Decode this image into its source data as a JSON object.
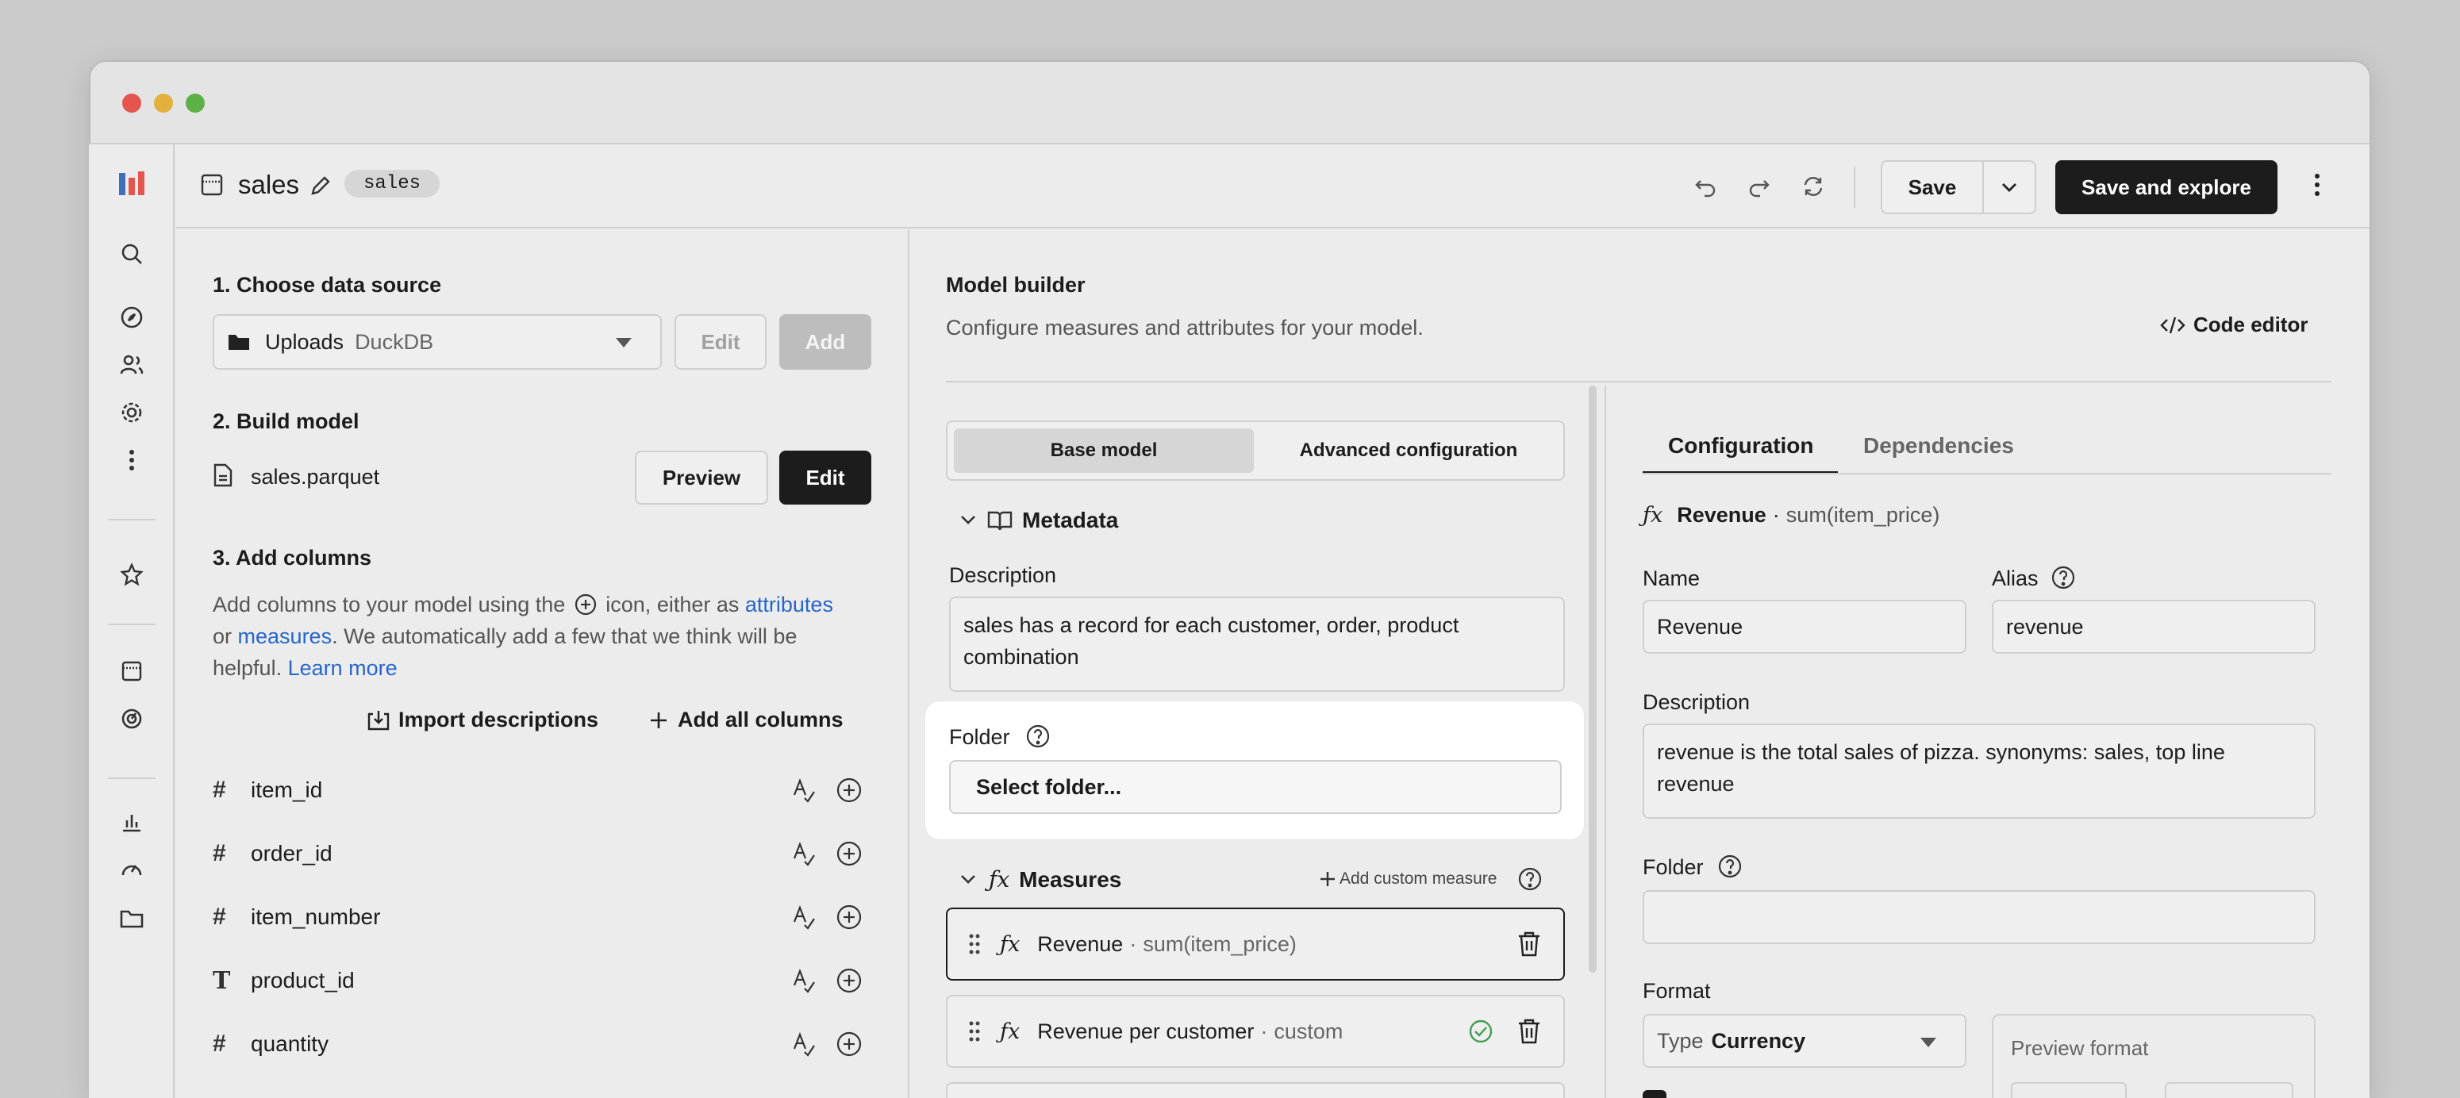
{
  "model": {
    "name": "sales",
    "tag": "sales"
  },
  "toolbar": {
    "save": "Save",
    "save_explore": "Save and explore"
  },
  "left": {
    "step1": "1. Choose data source",
    "source_label": "Uploads",
    "source_engine": "DuckDB",
    "edit": "Edit",
    "add": "Add",
    "step2": "2. Build model",
    "file": "sales.parquet",
    "preview": "Preview",
    "edit2": "Edit",
    "step3": "3. Add columns",
    "help_p1": "Add columns to your model using the",
    "help_p2": "icon, either as",
    "help_attributes": "attributes",
    "help_or": "or",
    "help_measures": "measures",
    "help_p3": ". We automatically add a few that we think will be",
    "help_p4": "helpful.",
    "help_learn": "Learn more",
    "import": "Import descriptions",
    "add_all": "Add all columns",
    "columns": [
      {
        "type": "#",
        "name": "item_id"
      },
      {
        "type": "#",
        "name": "order_id"
      },
      {
        "type": "#",
        "name": "item_number"
      },
      {
        "type": "T",
        "name": "product_id"
      },
      {
        "type": "#",
        "name": "quantity"
      }
    ]
  },
  "builder": {
    "title": "Model builder",
    "subtitle": "Configure measures and attributes for your model.",
    "code_editor": "Code editor",
    "tab_base": "Base model",
    "tab_advanced": "Advanced configuration",
    "metadata": "Metadata",
    "description_label": "Description",
    "description_value": "sales has a record for each customer, order, product combination",
    "folder_label": "Folder",
    "folder_placeholder": "Select folder...",
    "measures": "Measures",
    "add_custom": "Add custom measure",
    "measure_items": [
      {
        "name": "Revenue",
        "expr": "sum(item_price)"
      },
      {
        "name": "Revenue per customer",
        "expr": "custom"
      }
    ]
  },
  "config": {
    "tab_config": "Configuration",
    "tab_deps": "Dependencies",
    "header_name": "Revenue",
    "header_expr": "sum(item_price)",
    "name_label": "Name",
    "name_value": "Revenue",
    "alias_label": "Alias",
    "alias_value": "revenue",
    "description_label": "Description",
    "description_value": "revenue is the total sales of pizza. synonyms: sales, top line revenue",
    "folder_label": "Folder",
    "folder_value": "",
    "format_label": "Format",
    "type_label": "Type",
    "type_value": "Currency",
    "preview_label": "Preview format"
  },
  "colors": {
    "accent_link": "#2766c9",
    "dark_button": "#1c1c1c",
    "check_green": "#3f9e52"
  }
}
